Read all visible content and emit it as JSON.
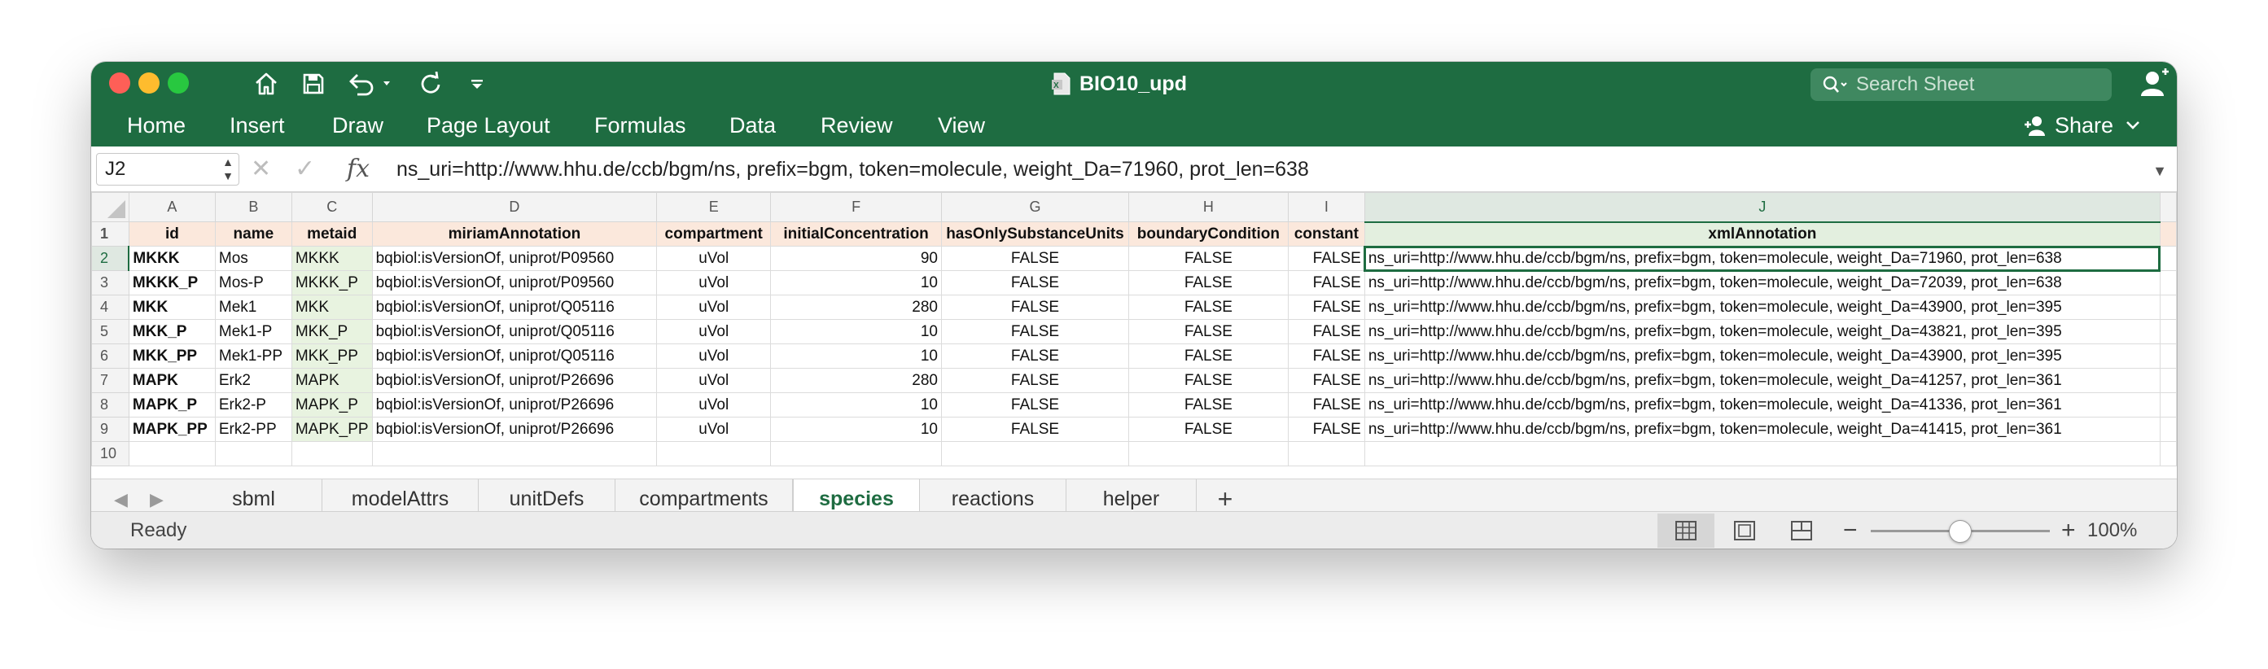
{
  "app": {
    "doc_title": "BIO10_upd",
    "search_placeholder": "Search Sheet",
    "share_label": "Share"
  },
  "ribbon_tabs": [
    "Home",
    "Insert",
    "Draw",
    "Page Layout",
    "Formulas",
    "Data",
    "Review",
    "View"
  ],
  "formula_bar": {
    "cell_ref": "J2",
    "fx": "fx",
    "content": "ns_uri=http://www.hhu.de/ccb/bgm/ns, prefix=bgm, token=molecule, weight_Da=71960, prot_len=638"
  },
  "columns": [
    "A",
    "B",
    "C",
    "D",
    "E",
    "F",
    "G",
    "H",
    "I",
    "J"
  ],
  "header_row": [
    "id",
    "name",
    "metaid",
    "miriamAnnotation",
    "compartment",
    "initialConcentration",
    "hasOnlySubstanceUnits",
    "boundaryCondition",
    "constant",
    "xmlAnnotation"
  ],
  "rows": [
    [
      "MKKK",
      "Mos",
      "MKKK",
      "bqbiol:isVersionOf, uniprot/P09560",
      "uVol",
      "90",
      "FALSE",
      "FALSE",
      "FALSE",
      "ns_uri=http://www.hhu.de/ccb/bgm/ns, prefix=bgm, token=molecule, weight_Da=71960, prot_len=638"
    ],
    [
      "MKKK_P",
      "Mos-P",
      "MKKK_P",
      "bqbiol:isVersionOf, uniprot/P09560",
      "uVol",
      "10",
      "FALSE",
      "FALSE",
      "FALSE",
      "ns_uri=http://www.hhu.de/ccb/bgm/ns, prefix=bgm, token=molecule, weight_Da=72039, prot_len=638"
    ],
    [
      "MKK",
      "Mek1",
      "MKK",
      "bqbiol:isVersionOf, uniprot/Q05116",
      "uVol",
      "280",
      "FALSE",
      "FALSE",
      "FALSE",
      "ns_uri=http://www.hhu.de/ccb/bgm/ns, prefix=bgm, token=molecule, weight_Da=43900, prot_len=395"
    ],
    [
      "MKK_P",
      "Mek1-P",
      "MKK_P",
      "bqbiol:isVersionOf, uniprot/Q05116",
      "uVol",
      "10",
      "FALSE",
      "FALSE",
      "FALSE",
      "ns_uri=http://www.hhu.de/ccb/bgm/ns, prefix=bgm, token=molecule, weight_Da=43821, prot_len=395"
    ],
    [
      "MKK_PP",
      "Mek1-PP",
      "MKK_PP",
      "bqbiol:isVersionOf, uniprot/Q05116",
      "uVol",
      "10",
      "FALSE",
      "FALSE",
      "FALSE",
      "ns_uri=http://www.hhu.de/ccb/bgm/ns, prefix=bgm, token=molecule, weight_Da=43900, prot_len=395"
    ],
    [
      "MAPK",
      "Erk2",
      "MAPK",
      "bqbiol:isVersionOf, uniprot/P26696",
      "uVol",
      "280",
      "FALSE",
      "FALSE",
      "FALSE",
      "ns_uri=http://www.hhu.de/ccb/bgm/ns, prefix=bgm, token=molecule, weight_Da=41257, prot_len=361"
    ],
    [
      "MAPK_P",
      "Erk2-P",
      "MAPK_P",
      "bqbiol:isVersionOf, uniprot/P26696",
      "uVol",
      "10",
      "FALSE",
      "FALSE",
      "FALSE",
      "ns_uri=http://www.hhu.de/ccb/bgm/ns, prefix=bgm, token=molecule, weight_Da=41336, prot_len=361"
    ],
    [
      "MAPK_PP",
      "Erk2-PP",
      "MAPK_PP",
      "bqbiol:isVersionOf, uniprot/P26696",
      "uVol",
      "10",
      "FALSE",
      "FALSE",
      "FALSE",
      "ns_uri=http://www.hhu.de/ccb/bgm/ns, prefix=bgm, token=molecule, weight_Da=41415, prot_len=361"
    ]
  ],
  "row_numbers": [
    "1",
    "2",
    "3",
    "4",
    "5",
    "6",
    "7",
    "8",
    "9",
    "10"
  ],
  "sheet_tabs": [
    "sbml",
    "modelAttrs",
    "unitDefs",
    "compartments",
    "species",
    "reactions",
    "helper"
  ],
  "active_sheet": "species",
  "add_sheet_label": "+",
  "status": {
    "text": "Ready",
    "zoom": "100%",
    "zoom_fraction": 0.5
  },
  "colors": {
    "accent": "#1e6c41",
    "header_fill": "#fbe8dc",
    "metaid_fill": "#e8f3e0"
  }
}
